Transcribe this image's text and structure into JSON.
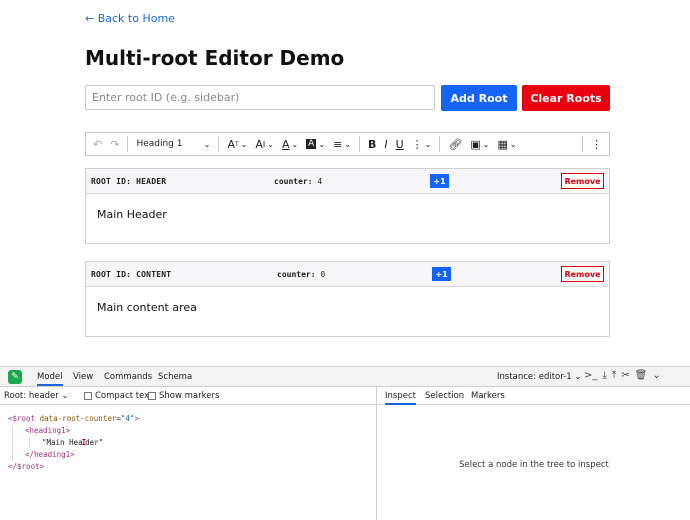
{
  "back_link": "← Back to Home",
  "page_title": "Multi-root Editor Demo",
  "root_input": {
    "placeholder": "Enter root ID (e.g. sidebar)",
    "value": ""
  },
  "buttons": {
    "add_root": "Add Root",
    "clear_roots": "Clear Roots"
  },
  "toolbar": {
    "heading_select": "Heading 1",
    "icons": [
      "undo-icon",
      "redo-icon",
      "font-size-icon",
      "font-family-icon",
      "font-color-icon",
      "font-background-icon",
      "alignment-icon",
      "bold-icon",
      "italic-icon",
      "underline-icon",
      "more-icon",
      "link-icon",
      "image-icon",
      "table-icon",
      "overflow-icon"
    ]
  },
  "roots": [
    {
      "id_label": "ROOT ID: HEADER",
      "counter_label": "counter:",
      "counter_value": "4",
      "increment_label": "+1",
      "remove_label": "Remove",
      "content": "Main Header"
    },
    {
      "id_label": "ROOT ID: CONTENT",
      "counter_label": "counter:",
      "counter_value": "0",
      "increment_label": "+1",
      "remove_label": "Remove",
      "content": "Main content area"
    }
  ],
  "inspector": {
    "tabs": [
      "Model",
      "View",
      "Commands",
      "Schema"
    ],
    "active_tab": "Model",
    "instance_label": "Instance:",
    "instance_value": "editor-1",
    "root_label": "Root:",
    "root_value": "header",
    "compact_text_label": "Compact text",
    "show_markers_label": "Show markers",
    "right_tabs": [
      "Inspect",
      "Selection",
      "Markers"
    ],
    "active_right_tab": "Inspect",
    "inspect_message": "Select a node in the tree to inspect",
    "tree": {
      "root_open": "<$root",
      "root_attr": "data-root-counter",
      "root_attr_value": "\"4\"",
      "root_open_end": ">",
      "heading_open": "<heading1>",
      "text_before": "\"Main Hea",
      "text_after": "der\"",
      "heading_close": "</heading1>",
      "root_close": "</$root>"
    }
  },
  "colors": {
    "primary": "#1664f5",
    "danger": "#e8000f",
    "link": "#1a66d9",
    "logo": "#1fa84f"
  }
}
